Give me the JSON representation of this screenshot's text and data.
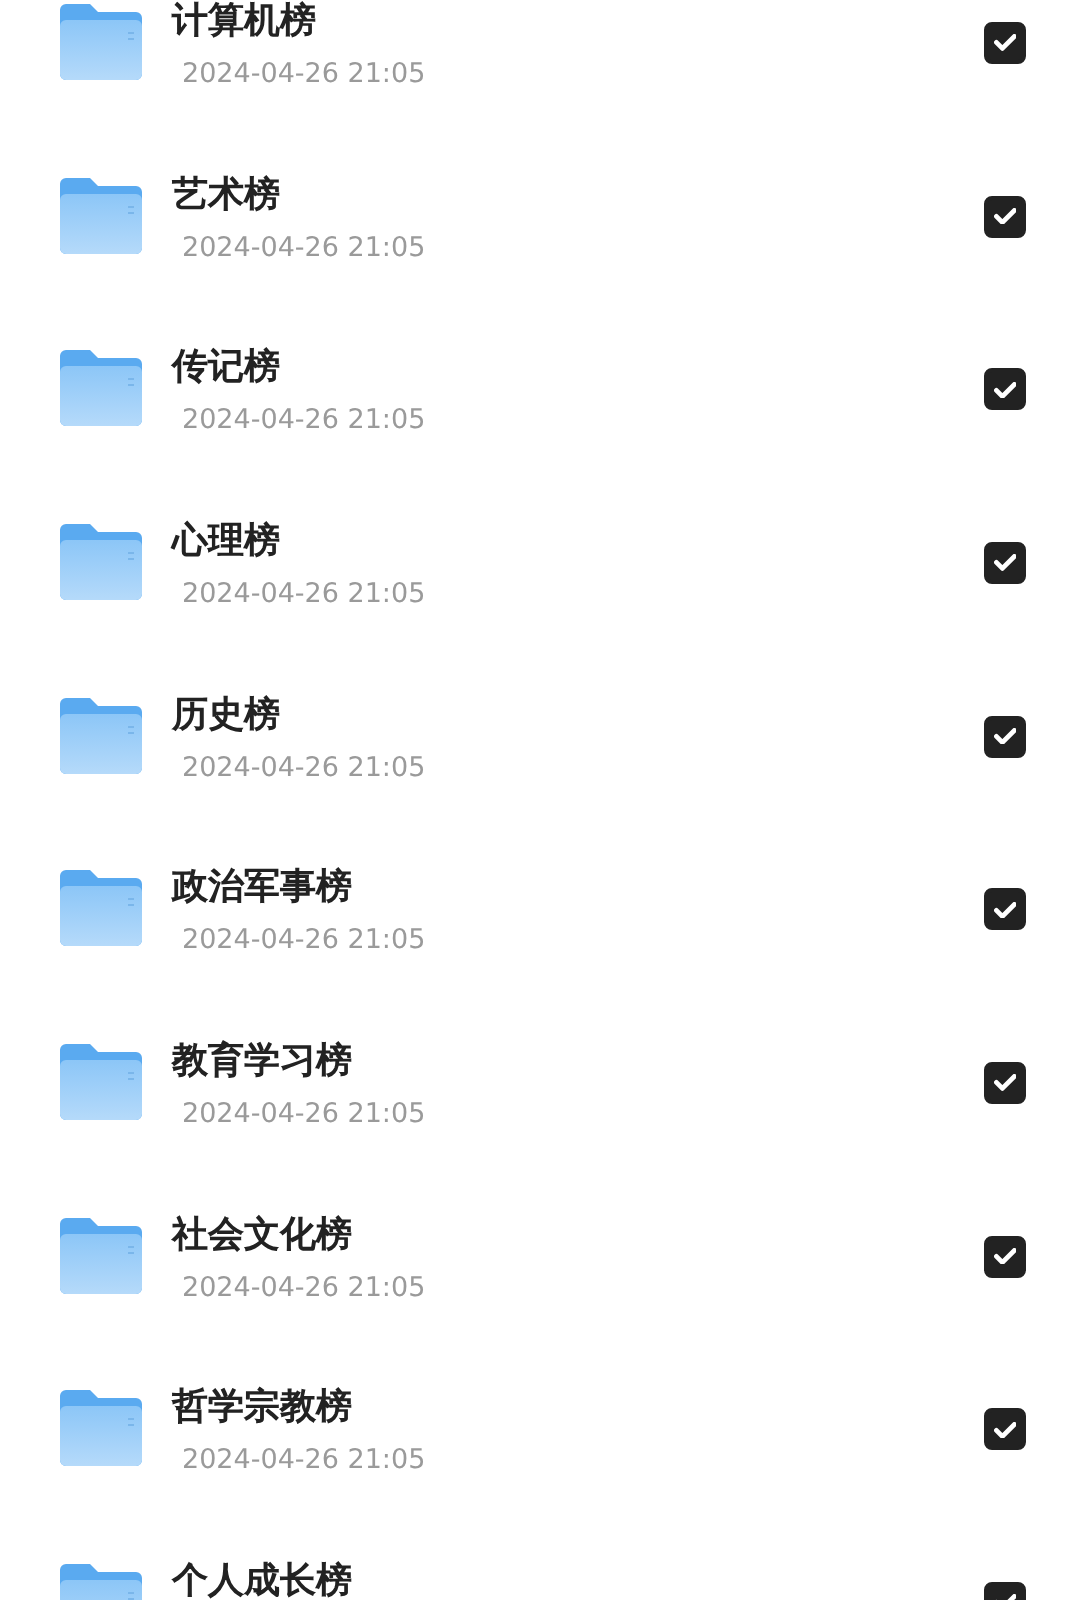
{
  "items": [
    {
      "title": "计算机榜",
      "date": "2024-04-26 21:05",
      "checked": true
    },
    {
      "title": "艺术榜",
      "date": "2024-04-26 21:05",
      "checked": true
    },
    {
      "title": "传记榜",
      "date": "2024-04-26 21:05",
      "checked": true
    },
    {
      "title": "心理榜",
      "date": "2024-04-26 21:05",
      "checked": true
    },
    {
      "title": "历史榜",
      "date": "2024-04-26 21:05",
      "checked": true
    },
    {
      "title": "政治军事榜",
      "date": "2024-04-26 21:05",
      "checked": true
    },
    {
      "title": "教育学习榜",
      "date": "2024-04-26 21:05",
      "checked": true
    },
    {
      "title": "社会文化榜",
      "date": "2024-04-26 21:05",
      "checked": true
    },
    {
      "title": "哲学宗教榜",
      "date": "2024-04-26 21:05",
      "checked": true
    },
    {
      "title": "个人成长榜",
      "checked": true
    }
  ]
}
